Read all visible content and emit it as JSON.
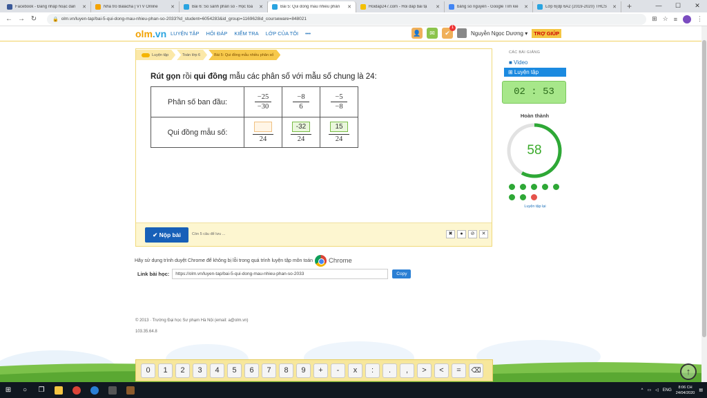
{
  "browser": {
    "tabs": [
      {
        "title": "Facebook - Đăng nhập hoặc đăn",
        "color": "#3b5998"
      },
      {
        "title": "Nhà tro Balacha | VTV Online",
        "color": "#f4a300"
      },
      {
        "title": "Bài 6: So sánh phân số - Học toá",
        "color": "#2aa4e0"
      },
      {
        "title": "Bài 5: Qui đồng mẫu nhiều phân",
        "color": "#2aa4e0",
        "active": true
      },
      {
        "title": "Hoidap247.com - Hỏi đáp bài tậ",
        "color": "#f4c000"
      },
      {
        "title": "bảng số nguyên - Google Tìm kiế",
        "color": "#4285f4"
      },
      {
        "title": "Lớp 6(dp 6A2 (2019-2020) THCS",
        "color": "#2aa4e0"
      }
    ],
    "url": "olm.vn/luyen-tap/bai-5-qui-dong-mau-nhieu-phan-so-2033?id_student=6054283&id_group=1169628id_courseware=848021"
  },
  "header": {
    "logo_a": "olm",
    "logo_b": ".vn",
    "nav": [
      "LUYỆN TẬP",
      "HỎI ĐÁP",
      "KIỂM TRA",
      "LỚP CỦA TÔI",
      "•••"
    ],
    "notif_count": "1",
    "user_name": "Nguyễn Ngọc Dương ▾",
    "help": "TRỢ GIÚP"
  },
  "breadcrumb": [
    "Luyện tập",
    "Toán lớp 6",
    "Bài 5: Qui đồng mẫu nhiều phân số"
  ],
  "question": {
    "p1": "Rút gọn",
    "p2": " rồi ",
    "p3": "qui đồng",
    "p4": " mẫu các phân số với mẫu số chung là 24:"
  },
  "table": {
    "row1_label": "Phân số ban đầu:",
    "row2_label": "Qui đồng mẫu số:",
    "fractions": [
      {
        "num": "−25",
        "den": "−30"
      },
      {
        "num": "−8",
        "den": "6"
      },
      {
        "num": "−5",
        "den": "−8"
      }
    ],
    "answers": [
      {
        "value": "",
        "den": "24"
      },
      {
        "value": "-32",
        "den": "24"
      },
      {
        "value": "15",
        "den": "24"
      }
    ]
  },
  "footer_bar": {
    "submit": "✔ Nộp bài",
    "remaining": "Còn 5 câu để lưu ..."
  },
  "chrome_note": {
    "text": "Hãy sử dụng trình duyệt Chrome để không bị lỗi trong quá trình luyện tập môn toán",
    "chrome": "Chrome"
  },
  "lesson_link": {
    "label": "Link bài học:",
    "value": "https://olm.vn/luyen-tap/bai-5-qui-dong-mau-nhieu-phan-so-2033",
    "copy": "Copy"
  },
  "site_footer": {
    "line1": "© 2013 · Trường Đại học Sư phạm Hà Nội (email: a@olm.vn)",
    "line2": "103.35.64.8"
  },
  "sidebar": {
    "section": "CÁC BÀI GIẢNG",
    "video": "■ Video",
    "practice": "⊞ Luyện tập",
    "timer": "02 : 53",
    "done_label": "Hoàn thành",
    "score": "58",
    "score_fraction": 0.58,
    "dots": [
      "#2ea836",
      "#2ea836",
      "#2ea836",
      "#2ea836",
      "#2ea836",
      "#2ea836",
      "#2ea836",
      "#e5534b"
    ],
    "retry": "Luyện tập lại"
  },
  "keypad": [
    "0",
    "1",
    "2",
    "3",
    "4",
    "5",
    "6",
    "7",
    "8",
    "9",
    "+",
    "-",
    "x",
    ":",
    ".",
    ",",
    ">",
    "<",
    "=",
    "⌫"
  ],
  "taskbar": {
    "lang": "ENG",
    "time": "8:06 CH",
    "date": "24/04/2020"
  }
}
